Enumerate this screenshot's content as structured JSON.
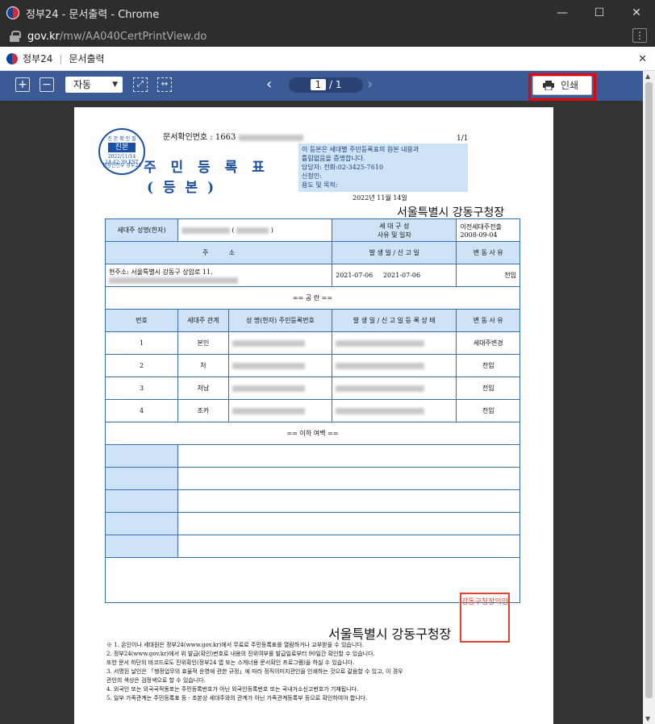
{
  "window": {
    "title": "정부24 - 문서출력 - Chrome",
    "minimize": "—",
    "maximize": "☐",
    "close": "✕"
  },
  "address": {
    "domain": "gov.kr",
    "path": "/mw/AA040CertPrintView.do"
  },
  "site": {
    "brand": "정부24",
    "separator": "|",
    "page": "문서출력",
    "close": "✕"
  },
  "toolbar": {
    "zoom_in": "+",
    "zoom_out": "−",
    "zoom_value": "자동",
    "page_current": "1",
    "page_sep": "/",
    "page_total": "1",
    "print_label": "인쇄"
  },
  "doc": {
    "doc_no_label": "문서확인번호 : 1663",
    "page_count": "1/1",
    "seal_top": "진 본 확 인 필",
    "seal_mid": "진본",
    "seal_date": "2022/11/14 14:42:39 KST",
    "seal_bottom": "행정안전부 정부24",
    "title": "주 민 등 록 표",
    "subtitle": "( 등        본 )",
    "cert_lines": [
      "이 등본은 세대별 주민등록표의 원본 내용과",
      "틀림없음을 증명합니다.",
      "담당자:                전화:02-3425-7610",
      "신청인:",
      "용도 및 목적:"
    ],
    "issued": "2022년 11월 14일",
    "office_top": "서울특별시 강동구청장",
    "row_head": [
      "세대주 성명(한자)",
      "(",
      ")",
      "세 대 구 성",
      "사유 및 일자",
      "이전세대주전출",
      "2008-09-04"
    ],
    "addr_head": [
      "주",
      "소",
      "발 생 일 / 신 고 일",
      "변 동 사 유"
    ],
    "current_addr_label": "현주소:",
    "current_addr": "서울특별시 강동구 상암로 11.",
    "current_dates": [
      "2021-07-06",
      "2021-07-06"
    ],
    "current_reason": "전입",
    "blank_line": "== 공 란 ==",
    "member_head": [
      "번호",
      "세대주\n관계",
      "성 명(한자)\n주민등록번호",
      "발 생 일 / 신 고 일\n등 록 상 태",
      "변 동 사 유"
    ],
    "members": [
      {
        "no": "1",
        "rel": "본인",
        "reason": "세대주변경"
      },
      {
        "no": "2",
        "rel": "처",
        "reason": "전입"
      },
      {
        "no": "3",
        "rel": "처남",
        "reason": "전입"
      },
      {
        "no": "4",
        "rel": "조카",
        "reason": "전입"
      }
    ],
    "end_line": "== 이하 여백 ==",
    "office_bottom": "서울특별시 강동구청장",
    "stamp": "강동구청장의인",
    "notes": [
      "※ 1. 온인이나 세대원은 정부24(www.gov.kr)에서 무료로 주민등록표를 열람하거나 교부받을 수 있습니다.",
      "2. 정부24(www.gov.kr)에서 위 발급(확인)번호로 내용의 진위여부를 발급일로부터 90일간 확인할 수 있습니다.",
      "또한 문서 하단의 바코드로도 진위확인(정부24 앱 또는 스캐너용 문서확인 프로그램)을 하실 수 있습니다.",
      "3. 서명된 날인은 「행정업무의 효율적 운영에 관한 규정」에 따라 정직이미지관인을 인쇄하는 것으로 갈음할 수 있고, 이 경우",
      "관인의 색상은 검정색으로 할 수 있습니다.",
      "4. 외국인 또는 외국국적동포는 주민등록번호가 아닌 외국인등록번호 또는 국내거소신고번호가 기재됩니다.",
      "5. 일부 가족관계는 주민등록표 등 · 초본상 세대주와의 관계가 아닌 가족관계등록부 등으로 확인하여야 합니다."
    ]
  }
}
